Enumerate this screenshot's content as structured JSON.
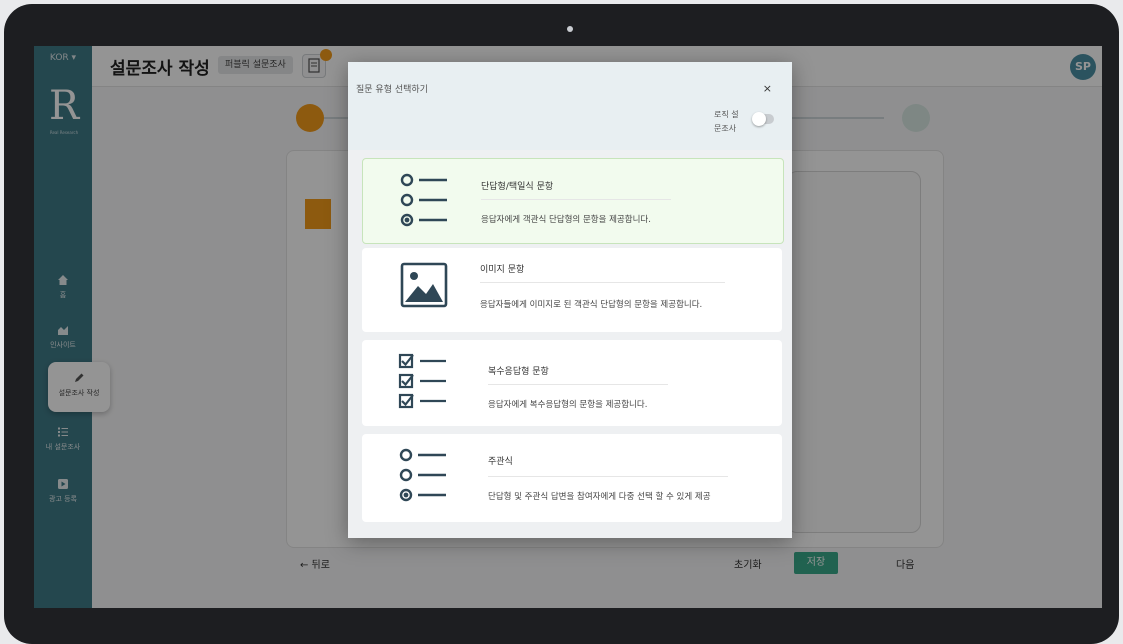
{
  "app": {
    "language": "KOR ▾",
    "logo_letters": "R",
    "logo_sub": "Real Research",
    "page_title": "설문조사 작성",
    "chip": "퍼블릭 설문조사",
    "avatar": "SP"
  },
  "sidebar": {
    "items": [
      {
        "label": "홈",
        "icon": "home-icon"
      },
      {
        "label": "인사이트",
        "icon": "chart-icon"
      },
      {
        "label": "설문조사 작성",
        "icon": "pencil-icon"
      },
      {
        "label": "내 설문조사",
        "icon": "list-icon"
      },
      {
        "label": "광고 등록",
        "icon": "play-icon"
      }
    ]
  },
  "footer": {
    "back": "← 뒤로",
    "reset": "초기화",
    "save": "저장",
    "next": "다음"
  },
  "modal": {
    "title": "질문 유형 선택하기",
    "close": "×",
    "logic_toggle": {
      "label": "로직 설문조사",
      "on": false
    },
    "options": [
      {
        "title": "단답형/택일식 문항",
        "desc": "응답자에게 객관식 단답형의 문항을 제공합니다.",
        "icon": "single-choice-icon",
        "selected": true
      },
      {
        "title": "이미지 문항",
        "desc": "응답자들에게 이미지로 된 객관식 단답형의 문항을 제공합니다.",
        "icon": "image-icon",
        "selected": false
      },
      {
        "title": "복수응답형 문항",
        "desc": "응답자에게 복수응답형의 문항을 제공합니다.",
        "icon": "checkbox-list-icon",
        "selected": false
      },
      {
        "title": "주관식",
        "desc": "단답형 및 주관식 답변을 참여자에게 다중 선택 할 수 있게 제공",
        "icon": "radio-list-icon",
        "selected": false
      }
    ]
  },
  "colors": {
    "sidebar": "#3f7a87",
    "accent_orange": "#f39c1b",
    "accent_green": "#3aaa8b",
    "icon_stroke": "#2f4756",
    "selected_bg": "#f2fbee"
  }
}
